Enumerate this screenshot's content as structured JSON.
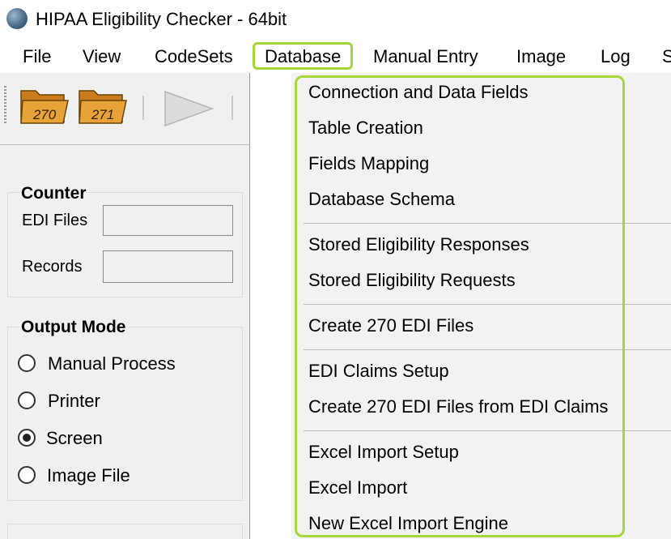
{
  "window": {
    "title": "HIPAA Eligibility Checker - 64bit"
  },
  "menubar": {
    "items": [
      "File",
      "View",
      "CodeSets",
      "Database",
      "Manual Entry",
      "Image",
      "Log",
      "S"
    ],
    "active": "Database"
  },
  "toolbar": {
    "btn270": "270",
    "btn271": "271"
  },
  "counter": {
    "title": "Counter",
    "edi_files_label": "EDI Files",
    "records_label": "Records",
    "edi_files_value": "",
    "records_value": ""
  },
  "output_mode": {
    "title": "Output Mode",
    "options": [
      "Manual Process",
      "Printer",
      "Screen",
      "Image File"
    ],
    "selected": "Screen"
  },
  "database_menu": {
    "group1": [
      "Connection and Data Fields",
      "Table Creation",
      "Fields Mapping",
      "Database Schema"
    ],
    "group2": [
      "Stored Eligibility Responses",
      "Stored Eligibility Requests"
    ],
    "group3": [
      "Create 270 EDI Files"
    ],
    "group4": [
      "EDI Claims Setup",
      "Create 270 EDI Files from EDI Claims"
    ],
    "group5": [
      "Excel Import Setup",
      "Excel Import",
      "New Excel Import Engine"
    ]
  },
  "colors": {
    "highlight": "#a6d63a",
    "panel": "#f0f0f0",
    "menu_bg": "#f2f2f2",
    "folder": "#e39b2f"
  }
}
